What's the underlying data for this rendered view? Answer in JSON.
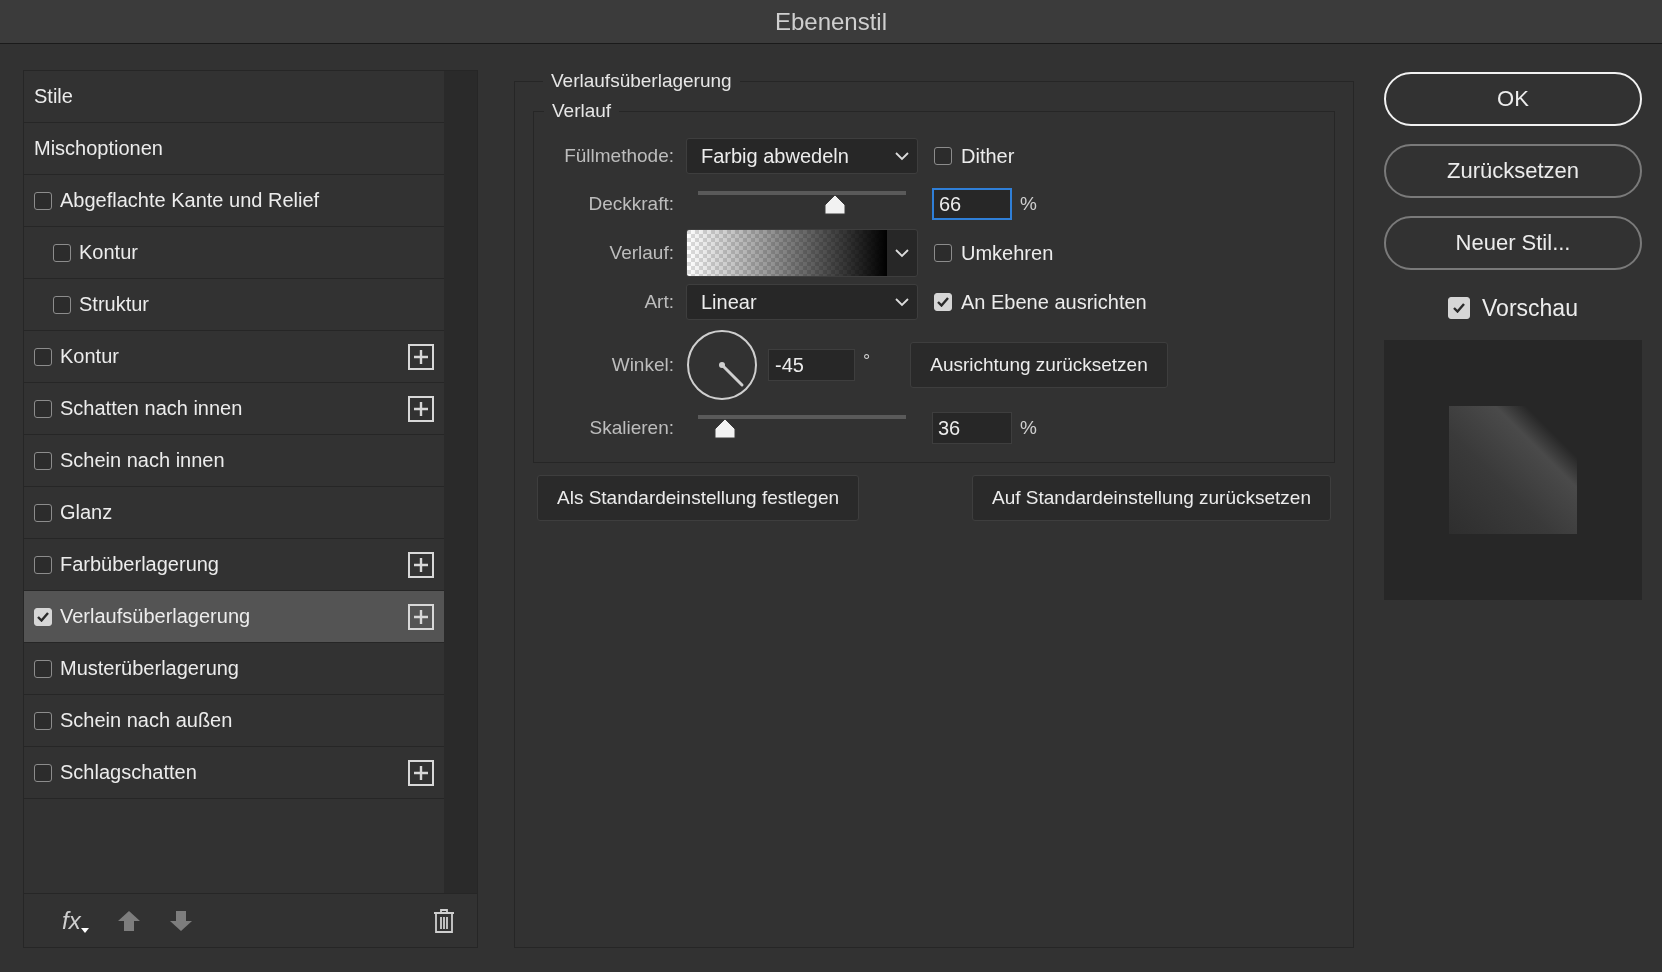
{
  "window": {
    "title": "Ebenenstil"
  },
  "sidebar": {
    "items": [
      {
        "label": "Stile",
        "kind": "header",
        "selected": false
      },
      {
        "label": "Mischoptionen",
        "kind": "header",
        "selected": false
      },
      {
        "label": "Abgeflachte Kante und Relief",
        "kind": "effect",
        "checked": false,
        "selected": false,
        "add": false,
        "children": [
          {
            "label": "Kontur",
            "kind": "effect",
            "checked": false,
            "selected": false,
            "add": false
          },
          {
            "label": "Struktur",
            "kind": "effect",
            "checked": false,
            "selected": false,
            "add": false
          }
        ]
      },
      {
        "label": "Kontur",
        "kind": "effect",
        "checked": false,
        "selected": false,
        "add": true
      },
      {
        "label": "Schatten nach innen",
        "kind": "effect",
        "checked": false,
        "selected": false,
        "add": true
      },
      {
        "label": "Schein nach innen",
        "kind": "effect",
        "checked": false,
        "selected": false,
        "add": false
      },
      {
        "label": "Glanz",
        "kind": "effect",
        "checked": false,
        "selected": false,
        "add": false
      },
      {
        "label": "Farbüberlagerung",
        "kind": "effect",
        "checked": false,
        "selected": false,
        "add": true
      },
      {
        "label": "Verlaufsüberlagerung",
        "kind": "effect",
        "checked": true,
        "selected": true,
        "add": true
      },
      {
        "label": "Musterüberlagerung",
        "kind": "effect",
        "checked": false,
        "selected": false,
        "add": false
      },
      {
        "label": "Schein nach außen",
        "kind": "effect",
        "checked": false,
        "selected": false,
        "add": false
      },
      {
        "label": "Schlagschatten",
        "kind": "effect",
        "checked": false,
        "selected": false,
        "add": true
      }
    ],
    "footer": {
      "fx_label": "fx"
    }
  },
  "panel": {
    "legend": "Verlaufsüberlagerung",
    "group": {
      "legend": "Verlauf",
      "fields": [
        {
          "kind": "select",
          "label": "Füllmethode:",
          "value": "Farbig abwedeln",
          "option": {
            "label": "Dither",
            "checked": false
          }
        },
        {
          "kind": "slider",
          "label": "Deckkraft:",
          "level": 0.66,
          "value": "66",
          "unit": "%",
          "focused": true
        },
        {
          "kind": "gradient",
          "label": "Verlauf:",
          "option": {
            "label": "Umkehren",
            "checked": false
          }
        },
        {
          "kind": "select",
          "label": "Art:",
          "value": "Linear",
          "option": {
            "label": "An Ebene ausrichten",
            "checked": true
          }
        },
        {
          "kind": "angle",
          "label": "Winkel:",
          "value": "-45",
          "unit": "°",
          "button": "Ausrichtung zurücksetzen"
        },
        {
          "kind": "slider",
          "label": "Skalieren:",
          "level": 0.13,
          "value": "36",
          "unit": "%",
          "focused": false
        }
      ]
    },
    "buttons": [
      "Als Standardeinstellung festlegen",
      "Auf Standardeinstellung zurücksetzen"
    ]
  },
  "actions": {
    "buttons": [
      {
        "label": "OK",
        "default": true
      },
      {
        "label": "Zurücksetzen",
        "default": false
      },
      {
        "label": "Neuer Stil...",
        "default": false
      }
    ],
    "preview": {
      "label": "Vorschau",
      "checked": true
    }
  }
}
